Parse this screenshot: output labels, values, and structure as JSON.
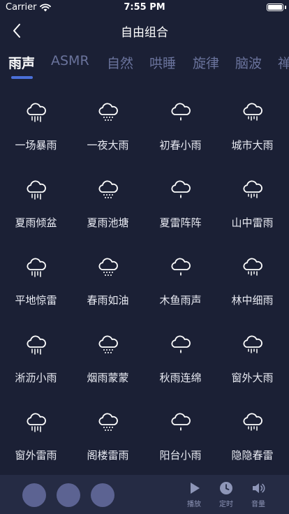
{
  "status_bar": {
    "carrier": "Carrier",
    "time": "7:55 PM",
    "battery_level": 1.0
  },
  "nav": {
    "title": "自由组合",
    "back_icon": "chevron-left-icon"
  },
  "tabs": [
    {
      "label": "雨声",
      "active": true
    },
    {
      "label": "ASMR",
      "active": false
    },
    {
      "label": "自然",
      "active": false
    },
    {
      "label": "哄睡",
      "active": false
    },
    {
      "label": "旋律",
      "active": false
    },
    {
      "label": "脑波",
      "active": false
    },
    {
      "label": "禅",
      "active": false
    }
  ],
  "sounds": [
    {
      "label": "一场暴雨",
      "icon": "heavy-rain-icon"
    },
    {
      "label": "一夜大雨",
      "icon": "rain-dots-icon"
    },
    {
      "label": "初春小雨",
      "icon": "light-drop-icon"
    },
    {
      "label": "城市大雨",
      "icon": "city-rain-icon"
    },
    {
      "label": "夏雨倾盆",
      "icon": "downpour-icon"
    },
    {
      "label": "夏雨池塘",
      "icon": "pond-rain-icon"
    },
    {
      "label": "夏雷阵阵",
      "icon": "thunder-star-icon"
    },
    {
      "label": "山中雷雨",
      "icon": "mountain-storm-icon"
    },
    {
      "label": "平地惊雷",
      "icon": "sudden-thunder-icon"
    },
    {
      "label": "春雨如油",
      "icon": "spring-rain-icon"
    },
    {
      "label": "木鱼雨声",
      "icon": "wooden-fish-rain-icon"
    },
    {
      "label": "林中细雨",
      "icon": "forest-drizzle-icon"
    },
    {
      "label": "淅沥小雨",
      "icon": "pattering-rain-icon"
    },
    {
      "label": "烟雨蒙蒙",
      "icon": "misty-rain-icon"
    },
    {
      "label": "秋雨连绵",
      "icon": "autumn-rain-icon"
    },
    {
      "label": "窗外大雨",
      "icon": "window-rain-icon"
    },
    {
      "label": "窗外雷雨",
      "icon": "window-thunder-icon"
    },
    {
      "label": "阁楼雷雨",
      "icon": "attic-storm-icon"
    },
    {
      "label": "阳台小雨",
      "icon": "balcony-rain-icon"
    },
    {
      "label": "隐隐春雷",
      "icon": "distant-thunder-icon"
    }
  ],
  "bottom_bar": {
    "slots": [
      "empty",
      "empty",
      "empty"
    ],
    "play_label": "播放",
    "timer_label": "定时",
    "volume_label": "音量"
  },
  "colors": {
    "background": "#1b2035",
    "tab_inactive": "#6a739c",
    "tab_indicator": "#4a6fd8",
    "bottom_bar": "#252b44",
    "slot": "#5c6392"
  }
}
